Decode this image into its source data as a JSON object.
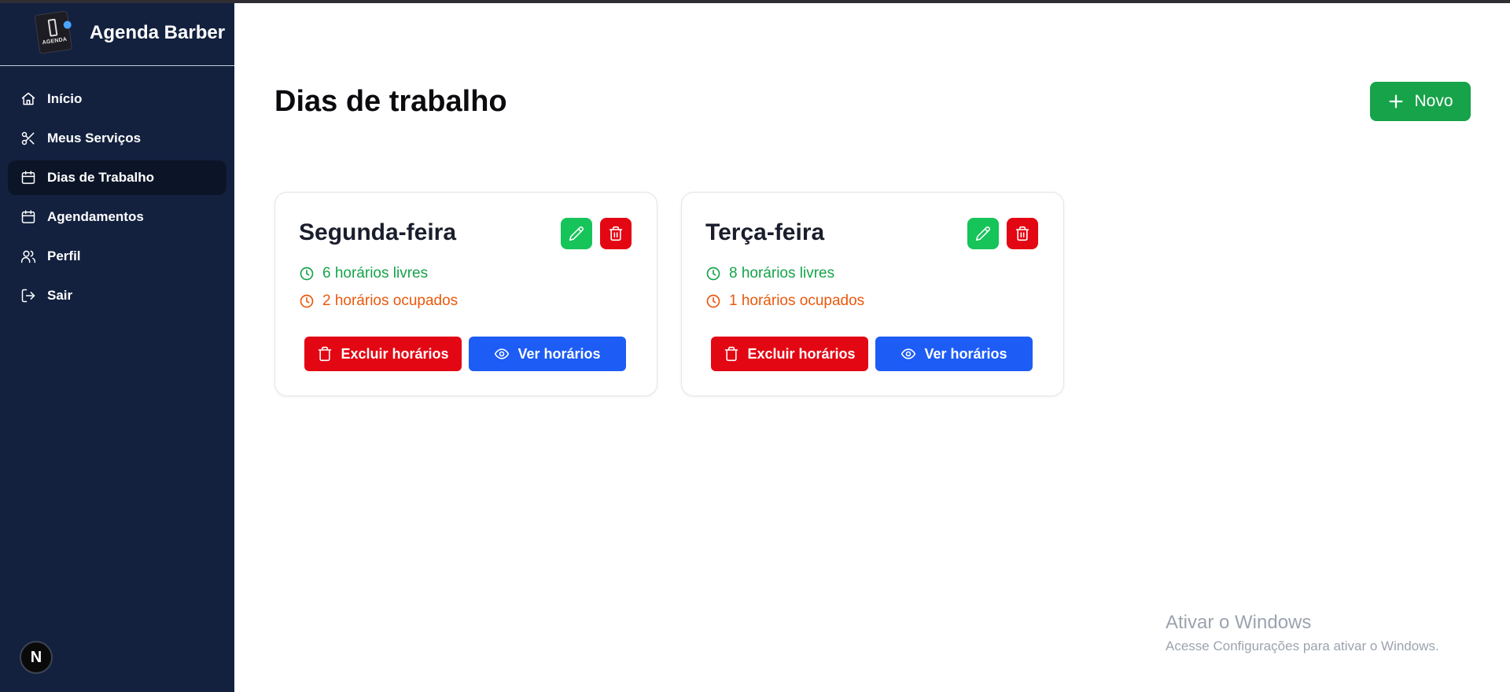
{
  "app": {
    "title": "Agenda Barber",
    "logo_text": "AGENDA"
  },
  "sidebar": {
    "items": [
      {
        "label": "Início",
        "icon": "home-icon",
        "active": false
      },
      {
        "label": "Meus Serviços",
        "icon": "scissors-icon",
        "active": false
      },
      {
        "label": "Dias de Trabalho",
        "icon": "calendar-icon",
        "active": true
      },
      {
        "label": "Agendamentos",
        "icon": "calendar-icon",
        "active": false
      },
      {
        "label": "Perfil",
        "icon": "users-icon",
        "active": false
      },
      {
        "label": "Sair",
        "icon": "logout-icon",
        "active": false
      }
    ],
    "badge": "N"
  },
  "main": {
    "title": "Dias de trabalho",
    "new_button": "Novo",
    "cards": [
      {
        "day": "Segunda-feira",
        "free": "6 horários livres",
        "busy": "2 horários ocupados",
        "delete_label": "Excluir horários",
        "view_label": "Ver horários"
      },
      {
        "day": "Terça-feira",
        "free": "8 horários livres",
        "busy": "1 horários ocupados",
        "delete_label": "Excluir horários",
        "view_label": "Ver horários"
      }
    ]
  },
  "watermark": {
    "line1": "Ativar o Windows",
    "line2": "Acesse Configurações para ativar o Windows."
  },
  "colors": {
    "sidebar": "#13213f",
    "active_item": "#0c1528",
    "green": "#16a34a",
    "red": "#e30613",
    "blue": "#1d5cf5",
    "orange": "#ea580c"
  }
}
